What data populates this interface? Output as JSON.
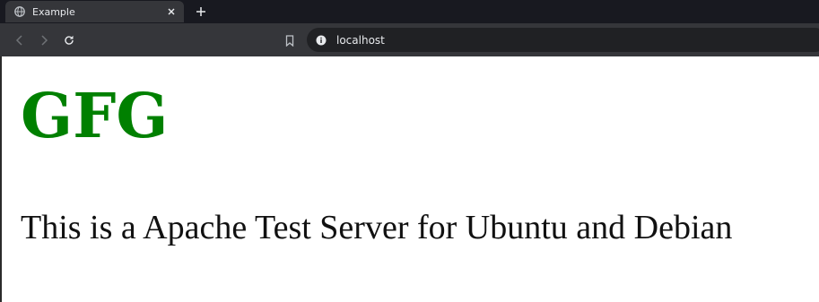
{
  "browser": {
    "tab": {
      "title": "Example",
      "favicon": "globe-icon",
      "close_icon": "close-icon"
    },
    "new_tab_icon": "plus-icon",
    "toolbar": {
      "back_icon": "chevron-left-icon",
      "forward_icon": "chevron-right-icon",
      "reload_icon": "reload-icon",
      "bookmark_icon": "bookmark-icon",
      "site_info_icon": "info-icon",
      "url": "localhost"
    },
    "colors": {
      "tabstrip_bg": "#181920",
      "toolbar_bg": "#35363a",
      "omnibox_bg": "#202124"
    }
  },
  "page": {
    "heading": "GFG",
    "paragraph": "This is a Apache Test Server for Ubuntu and Debian",
    "colors": {
      "heading": "#008000",
      "text": "#111111",
      "background": "#ffffff"
    }
  }
}
